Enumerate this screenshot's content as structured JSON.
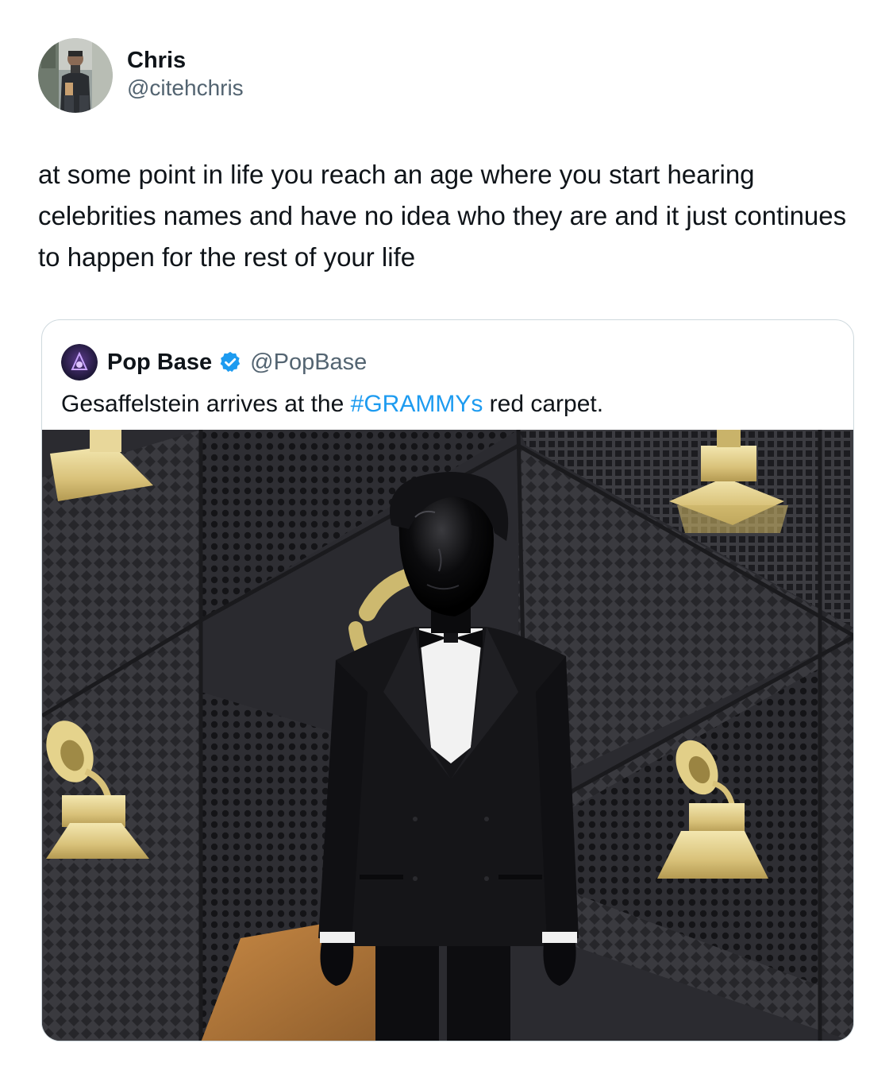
{
  "author": {
    "display_name": "Chris",
    "handle": "@citehchris",
    "avatar_icon": "user-photo-avatar"
  },
  "tweet": {
    "text": "at some point in life you reach an age where you start hearing celebrities names and have no idea who they are and it just continues to happen for the rest of your life"
  },
  "quote": {
    "display_name": "Pop Base",
    "verified_icon": "verified-badge-icon",
    "handle": "@PopBase",
    "text_before": "Gesaffelstein arrives at the ",
    "hashtag": "#GRAMMYs",
    "text_after": " red carpet.",
    "media_icon": "photo-man-in-tuxedo-with-black-mask"
  },
  "colors": {
    "text": "#0f1419",
    "secondary": "#536471",
    "link": "#1d9bf0",
    "border": "#cfd9de",
    "verified": "#1d9bf0"
  }
}
